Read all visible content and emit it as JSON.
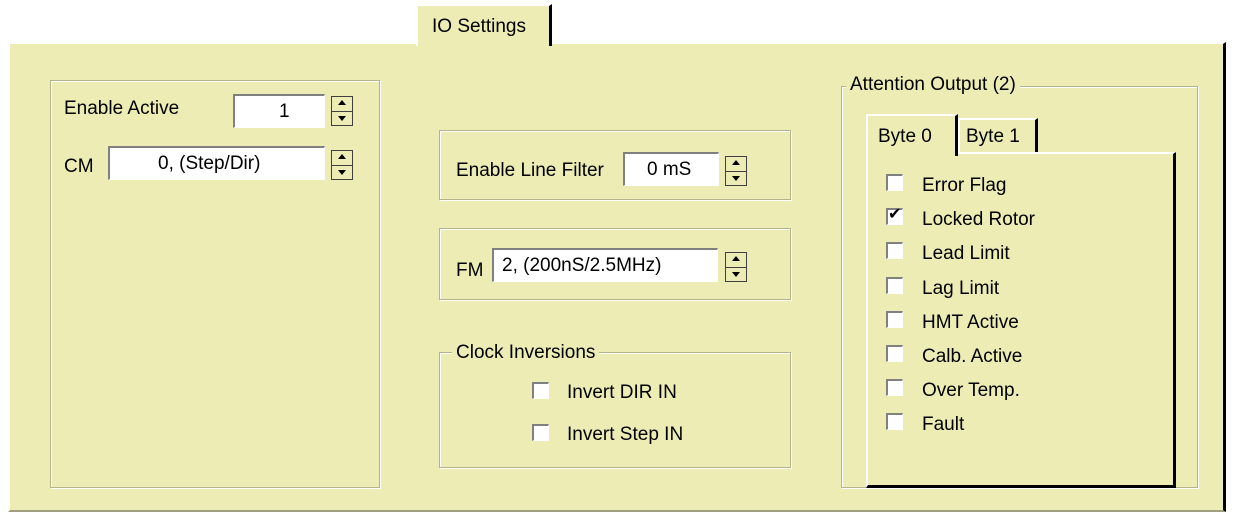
{
  "tab": {
    "label": "IO Settings"
  },
  "left": {
    "enable_active_label": "Enable Active",
    "enable_active_value": "1",
    "cm_label": "CM",
    "cm_value": "0,  (Step/Dir)"
  },
  "middle": {
    "line_filter_label": "Enable Line Filter",
    "line_filter_value": "0 mS",
    "fm_label": "FM",
    "fm_value": "2, (200nS/2.5MHz)",
    "clock_inversions": {
      "title": "Clock Inversions",
      "items": [
        {
          "label": "Invert DIR IN",
          "checked": false
        },
        {
          "label": "Invert Step IN",
          "checked": false
        }
      ]
    }
  },
  "attention": {
    "title": "Attention Output  (2)",
    "tabs": [
      "Byte 0",
      "Byte 1"
    ],
    "items": [
      {
        "label": "Error Flag",
        "checked": false
      },
      {
        "label": "Locked Rotor",
        "checked": true
      },
      {
        "label": "Lead Limit",
        "checked": false
      },
      {
        "label": "Lag Limit",
        "checked": false
      },
      {
        "label": "HMT Active",
        "checked": false
      },
      {
        "label": "Calb. Active",
        "checked": false
      },
      {
        "label": "Over Temp.",
        "checked": false
      },
      {
        "label": "Fault",
        "checked": false
      }
    ]
  },
  "colors": {
    "panel": "#ececb4",
    "frame": "#b4b48c"
  }
}
